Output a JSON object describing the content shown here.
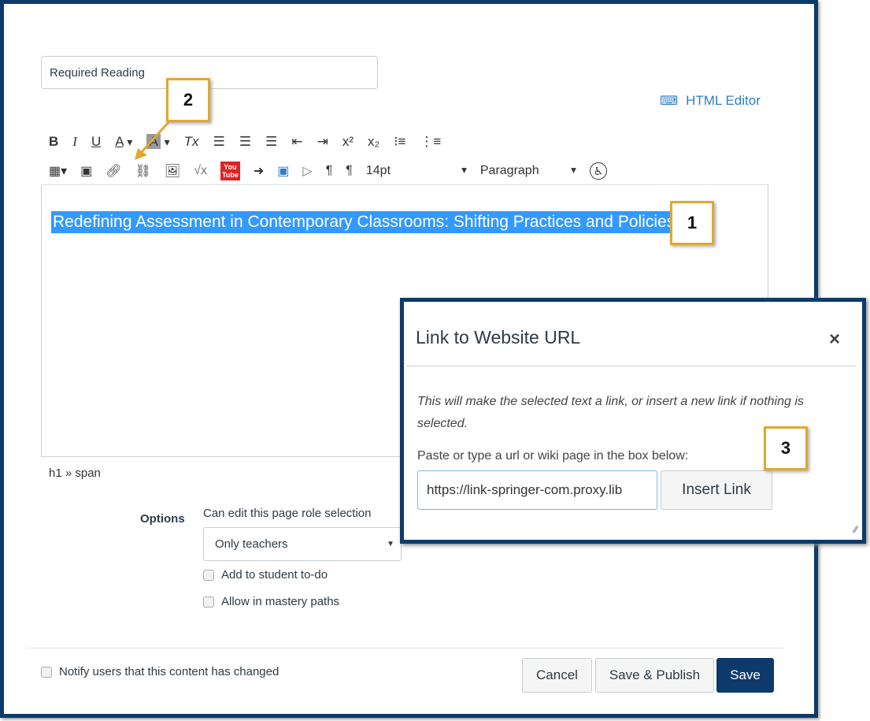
{
  "page": {
    "title_value": "Required Reading",
    "html_editor_label": "HTML Editor",
    "breadcrumb_path": "h1 » span"
  },
  "toolbar": {
    "row1": [
      "B",
      "I",
      "U",
      "A",
      "A",
      "Tx",
      "align-left",
      "align-center",
      "align-right",
      "outdent",
      "indent",
      "x²",
      "x₂",
      "bullet-list",
      "numbered-list"
    ],
    "font_size": "14pt",
    "block_format": "Paragraph"
  },
  "editor": {
    "selected_text": "Redefining Assessment in Contemporary Classrooms: Shifting Practices and Policies"
  },
  "callouts": [
    "1",
    "2",
    "3"
  ],
  "dialog": {
    "title": "Link to Website URL",
    "close": "×",
    "description": "This will make the selected text a link, or insert a new link if nothing is selected.",
    "prompt": "Paste or type a url or wiki page in the box below:",
    "url_value": "https://link-springer-com.proxy.lib",
    "insert_label": "Insert Link"
  },
  "options": {
    "label": "Options",
    "role_label": "Can edit this page role selection",
    "role_value": "Only teachers",
    "todo_label": "Add to student to-do",
    "mastery_label": "Allow in mastery paths"
  },
  "footer": {
    "notify_label": "Notify users that this content has changed",
    "cancel": "Cancel",
    "save_publish": "Save & Publish",
    "save": "Save"
  },
  "colors": {
    "frame": "#0d3a6b",
    "callout": "#e0a82e",
    "selection": "#3399ff",
    "primary": "#0d3a6b",
    "link": "#2d7ec4"
  }
}
